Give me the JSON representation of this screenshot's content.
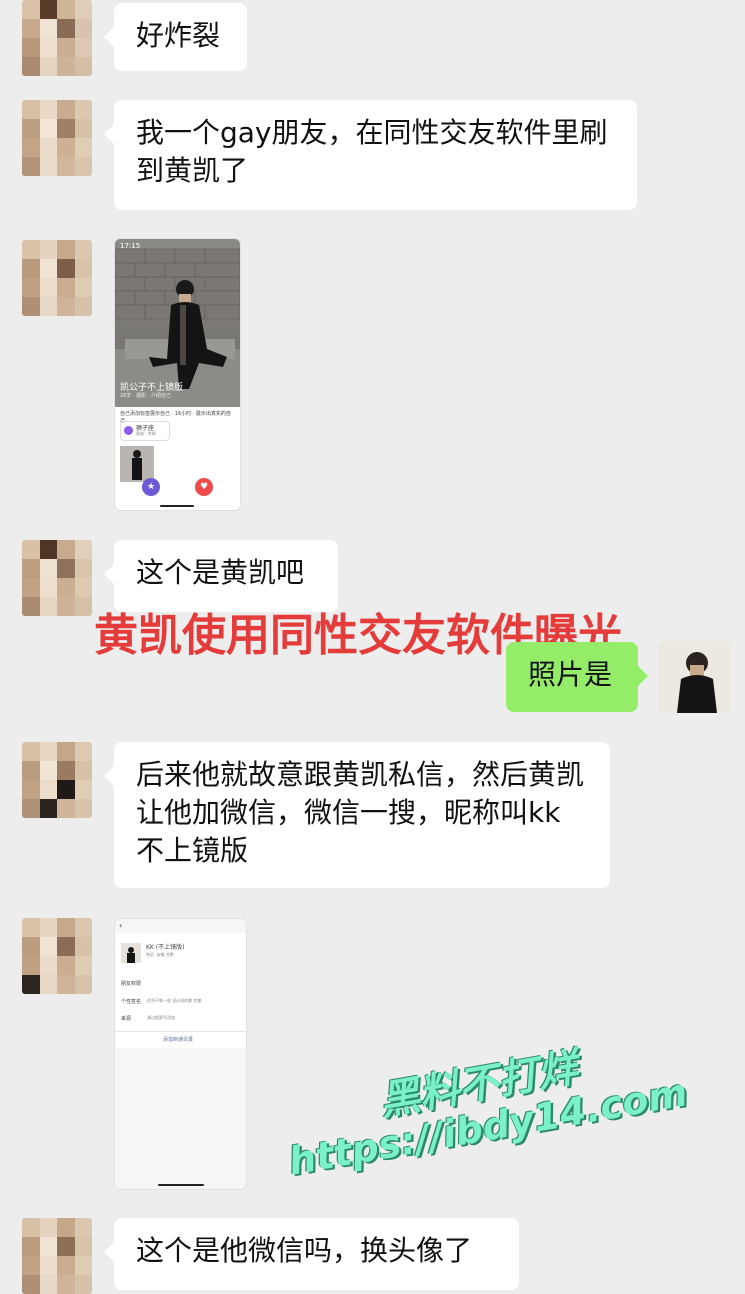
{
  "messages": [
    {
      "text": "好炸裂"
    },
    {
      "text": "我一个gay朋友，在同性交友软件里刷到黄凯了"
    },
    {
      "text": "这个是黄凯吧"
    },
    {
      "text": "后来他就故意跟黄凯私信，然后黄凯让他加微信，微信一搜，昵称叫kk 不上镜版"
    },
    {
      "text": "这个是他微信吗，换头像了"
    }
  ],
  "reply": {
    "text": "照片是"
  },
  "overlay_title": "黄凯使用同性交友软件曝光",
  "watermark": {
    "line1": "黑料不打烊",
    "line2": "https://ibdy14.com"
  },
  "shot1": {
    "time": "17:15",
    "caption": "凯公子不上镜版",
    "caption_sub": "28岁 · 摄影 · 介绍自己",
    "desc": "自己添加标签展示自己 · 16小时 · 展示出真实的自己",
    "tag_name": "狮子座",
    "tag_sub": "星座 · 性格"
  },
  "shot2": {
    "name": "KK (不上镜版)",
    "region": "地区: 安徽 合肥",
    "row1": "朋友权限",
    "sig_label": "个性签名",
    "sig_value": "优秀不够一般 但必须的都 完美",
    "src_label": "来源",
    "src_value": "通过搜索号添加",
    "action": "添加到通讯录"
  },
  "colors": {
    "bubble_green": "#95ec69",
    "overlay_red": "#e63b3b",
    "watermark": "#7cf0c8"
  }
}
